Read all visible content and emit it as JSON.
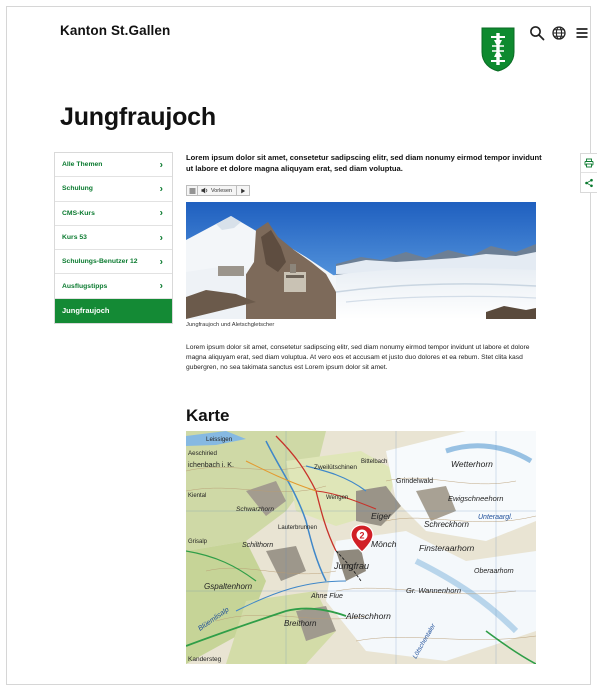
{
  "header": {
    "logo_text": "Kanton St.Gallen",
    "icons": [
      "search-icon",
      "language-icon",
      "menu-icon"
    ]
  },
  "page": {
    "title": "Jungfraujoch"
  },
  "sidebar": {
    "items": [
      {
        "label": "Alle Themen"
      },
      {
        "label": "Schulung"
      },
      {
        "label": "CMS-Kurs"
      },
      {
        "label": "Kurs 53"
      },
      {
        "label": "Schulungs-Benutzer 12"
      },
      {
        "label": "Ausflugstipps"
      },
      {
        "label": "Jungfraujoch",
        "active": true
      }
    ]
  },
  "main": {
    "lead": "Lorem ipsum dolor sit amet, consetetur sadipscing elitr, sed diam nonumy eirmod tempor invidunt ut labore et dolore magna aliquyam erat, sed diam voluptua.",
    "audio": {
      "read_label": "Vorlesen"
    },
    "image_caption": "Jungfraujoch und Aletschgletscher",
    "body": "Lorem ipsum dolor sit amet, consetetur sadipscing elitr, sed diam nonumy eirmod tempor invidunt ut labore et dolore magna aliquyam erat, sed diam voluptua. At vero eos et accusam et justo duo dolores et ea rebum. Stet clita kasd gubergren, no sea takimata sanctus est Lorem ipsum dolor sit amet.",
    "map_section_title": "Karte"
  },
  "map": {
    "marker_label": "2",
    "labels": [
      "Leissigen",
      "Aeschiried",
      "ichenbach i. K.",
      "Zweilütschinen",
      "Wetterhorn",
      "Grindelwald",
      "Schwarzhorn",
      "Wengen",
      "Eiger",
      "Schreckhorn",
      "Mönch",
      "Finsteraarhorn",
      "Jungfrau",
      "Aletschhorn",
      "Breithorn",
      "Gspaltenhorn",
      "Schilthorn",
      "Lauterbrunnen",
      "Bittelbach",
      "Kiental",
      "Kandersteg",
      "Blüemlisalp",
      "Oberaarhorn",
      "Gr. Wannenhorn",
      "Unteraargl.",
      "Lötschentaler",
      "Ewigschneehorn",
      "Grisalp",
      "Ahne Flue"
    ]
  },
  "colors": {
    "accent_green": "#148a35",
    "link_green": "#0a7a2f",
    "sky_blue": "#2f73c9"
  }
}
